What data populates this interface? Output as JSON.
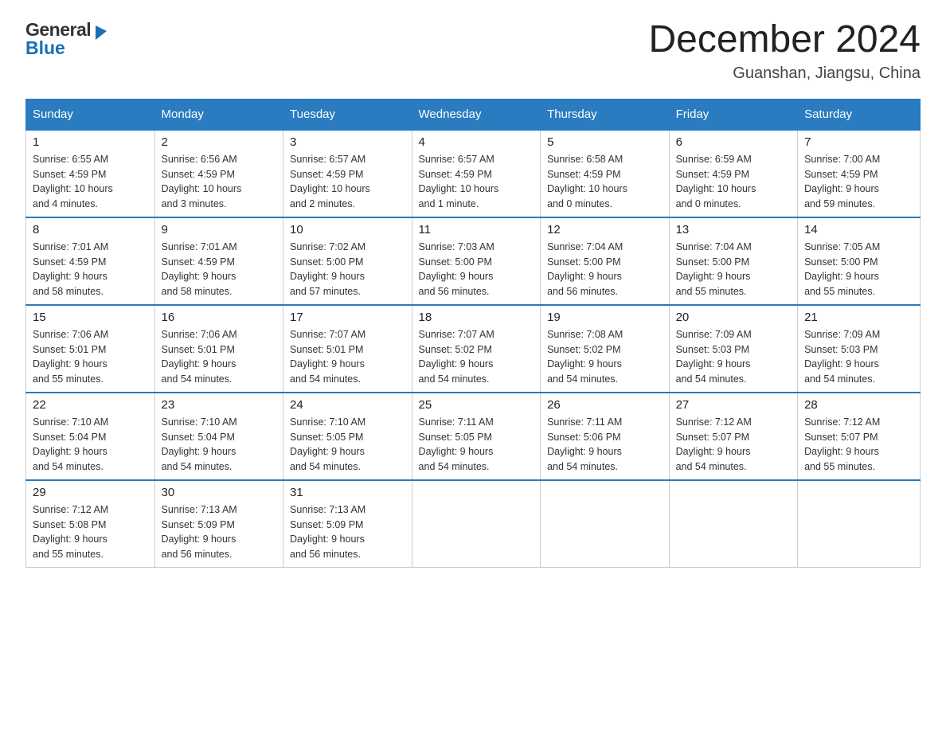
{
  "header": {
    "logo": {
      "general": "General",
      "triangle": "▶",
      "blue": "Blue"
    },
    "title": "December 2024",
    "location": "Guanshan, Jiangsu, China"
  },
  "calendar": {
    "days": [
      "Sunday",
      "Monday",
      "Tuesday",
      "Wednesday",
      "Thursday",
      "Friday",
      "Saturday"
    ],
    "weeks": [
      [
        {
          "day": "1",
          "info": "Sunrise: 6:55 AM\nSunset: 4:59 PM\nDaylight: 10 hours\nand 4 minutes."
        },
        {
          "day": "2",
          "info": "Sunrise: 6:56 AM\nSunset: 4:59 PM\nDaylight: 10 hours\nand 3 minutes."
        },
        {
          "day": "3",
          "info": "Sunrise: 6:57 AM\nSunset: 4:59 PM\nDaylight: 10 hours\nand 2 minutes."
        },
        {
          "day": "4",
          "info": "Sunrise: 6:57 AM\nSunset: 4:59 PM\nDaylight: 10 hours\nand 1 minute."
        },
        {
          "day": "5",
          "info": "Sunrise: 6:58 AM\nSunset: 4:59 PM\nDaylight: 10 hours\nand 0 minutes."
        },
        {
          "day": "6",
          "info": "Sunrise: 6:59 AM\nSunset: 4:59 PM\nDaylight: 10 hours\nand 0 minutes."
        },
        {
          "day": "7",
          "info": "Sunrise: 7:00 AM\nSunset: 4:59 PM\nDaylight: 9 hours\nand 59 minutes."
        }
      ],
      [
        {
          "day": "8",
          "info": "Sunrise: 7:01 AM\nSunset: 4:59 PM\nDaylight: 9 hours\nand 58 minutes."
        },
        {
          "day": "9",
          "info": "Sunrise: 7:01 AM\nSunset: 4:59 PM\nDaylight: 9 hours\nand 58 minutes."
        },
        {
          "day": "10",
          "info": "Sunrise: 7:02 AM\nSunset: 5:00 PM\nDaylight: 9 hours\nand 57 minutes."
        },
        {
          "day": "11",
          "info": "Sunrise: 7:03 AM\nSunset: 5:00 PM\nDaylight: 9 hours\nand 56 minutes."
        },
        {
          "day": "12",
          "info": "Sunrise: 7:04 AM\nSunset: 5:00 PM\nDaylight: 9 hours\nand 56 minutes."
        },
        {
          "day": "13",
          "info": "Sunrise: 7:04 AM\nSunset: 5:00 PM\nDaylight: 9 hours\nand 55 minutes."
        },
        {
          "day": "14",
          "info": "Sunrise: 7:05 AM\nSunset: 5:00 PM\nDaylight: 9 hours\nand 55 minutes."
        }
      ],
      [
        {
          "day": "15",
          "info": "Sunrise: 7:06 AM\nSunset: 5:01 PM\nDaylight: 9 hours\nand 55 minutes."
        },
        {
          "day": "16",
          "info": "Sunrise: 7:06 AM\nSunset: 5:01 PM\nDaylight: 9 hours\nand 54 minutes."
        },
        {
          "day": "17",
          "info": "Sunrise: 7:07 AM\nSunset: 5:01 PM\nDaylight: 9 hours\nand 54 minutes."
        },
        {
          "day": "18",
          "info": "Sunrise: 7:07 AM\nSunset: 5:02 PM\nDaylight: 9 hours\nand 54 minutes."
        },
        {
          "day": "19",
          "info": "Sunrise: 7:08 AM\nSunset: 5:02 PM\nDaylight: 9 hours\nand 54 minutes."
        },
        {
          "day": "20",
          "info": "Sunrise: 7:09 AM\nSunset: 5:03 PM\nDaylight: 9 hours\nand 54 minutes."
        },
        {
          "day": "21",
          "info": "Sunrise: 7:09 AM\nSunset: 5:03 PM\nDaylight: 9 hours\nand 54 minutes."
        }
      ],
      [
        {
          "day": "22",
          "info": "Sunrise: 7:10 AM\nSunset: 5:04 PM\nDaylight: 9 hours\nand 54 minutes."
        },
        {
          "day": "23",
          "info": "Sunrise: 7:10 AM\nSunset: 5:04 PM\nDaylight: 9 hours\nand 54 minutes."
        },
        {
          "day": "24",
          "info": "Sunrise: 7:10 AM\nSunset: 5:05 PM\nDaylight: 9 hours\nand 54 minutes."
        },
        {
          "day": "25",
          "info": "Sunrise: 7:11 AM\nSunset: 5:05 PM\nDaylight: 9 hours\nand 54 minutes."
        },
        {
          "day": "26",
          "info": "Sunrise: 7:11 AM\nSunset: 5:06 PM\nDaylight: 9 hours\nand 54 minutes."
        },
        {
          "day": "27",
          "info": "Sunrise: 7:12 AM\nSunset: 5:07 PM\nDaylight: 9 hours\nand 54 minutes."
        },
        {
          "day": "28",
          "info": "Sunrise: 7:12 AM\nSunset: 5:07 PM\nDaylight: 9 hours\nand 55 minutes."
        }
      ],
      [
        {
          "day": "29",
          "info": "Sunrise: 7:12 AM\nSunset: 5:08 PM\nDaylight: 9 hours\nand 55 minutes."
        },
        {
          "day": "30",
          "info": "Sunrise: 7:13 AM\nSunset: 5:09 PM\nDaylight: 9 hours\nand 56 minutes."
        },
        {
          "day": "31",
          "info": "Sunrise: 7:13 AM\nSunset: 5:09 PM\nDaylight: 9 hours\nand 56 minutes."
        },
        {
          "day": "",
          "info": ""
        },
        {
          "day": "",
          "info": ""
        },
        {
          "day": "",
          "info": ""
        },
        {
          "day": "",
          "info": ""
        }
      ]
    ]
  }
}
